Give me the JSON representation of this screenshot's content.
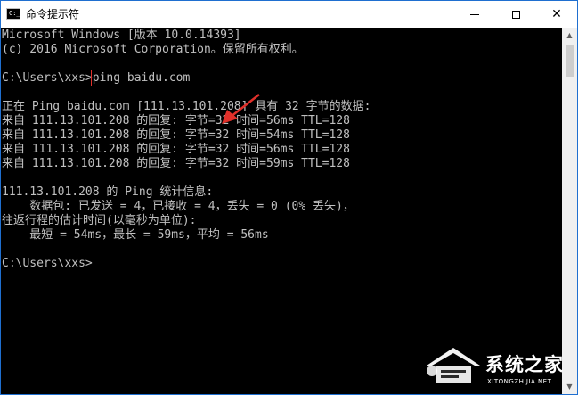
{
  "window": {
    "title": "命令提示符",
    "accent_color": "#1f6fd0",
    "controls": {
      "minimize_icon": "minimize-icon",
      "maximize_icon": "maximize-icon",
      "close_icon": "close-icon",
      "close_glyph": "✕"
    }
  },
  "console": {
    "background": "#000000",
    "foreground": "#c0c0c0",
    "lines": [
      "Microsoft Windows [版本 10.0.14393]",
      "(c) 2016 Microsoft Corporation。保留所有权利。",
      "",
      "C:\\Users\\xxs>",
      "",
      "正在 Ping baidu.com [111.13.101.208] 具有 32 字节的数据:",
      "来自 111.13.101.208 的回复: 字节=32 时间=56ms TTL=128",
      "来自 111.13.101.208 的回复: 字节=32 时间=54ms TTL=128",
      "来自 111.13.101.208 的回复: 字节=32 时间=56ms TTL=128",
      "来自 111.13.101.208 的回复: 字节=32 时间=59ms TTL=128",
      "",
      "111.13.101.208 的 Ping 统计信息:",
      "    数据包: 已发送 = 4，已接收 = 4，丢失 = 0 (0% 丢失)，",
      "往返行程的估计时间(以毫秒为单位):",
      "    最短 = 54ms，最长 = 59ms，平均 = 56ms",
      "",
      "C:\\Users\\xxs>"
    ],
    "command": "ping baidu.com",
    "highlight_color": "#e0302a"
  },
  "watermark": {
    "name": "系统之家",
    "url": "XITONGZHIJIA.NET"
  }
}
